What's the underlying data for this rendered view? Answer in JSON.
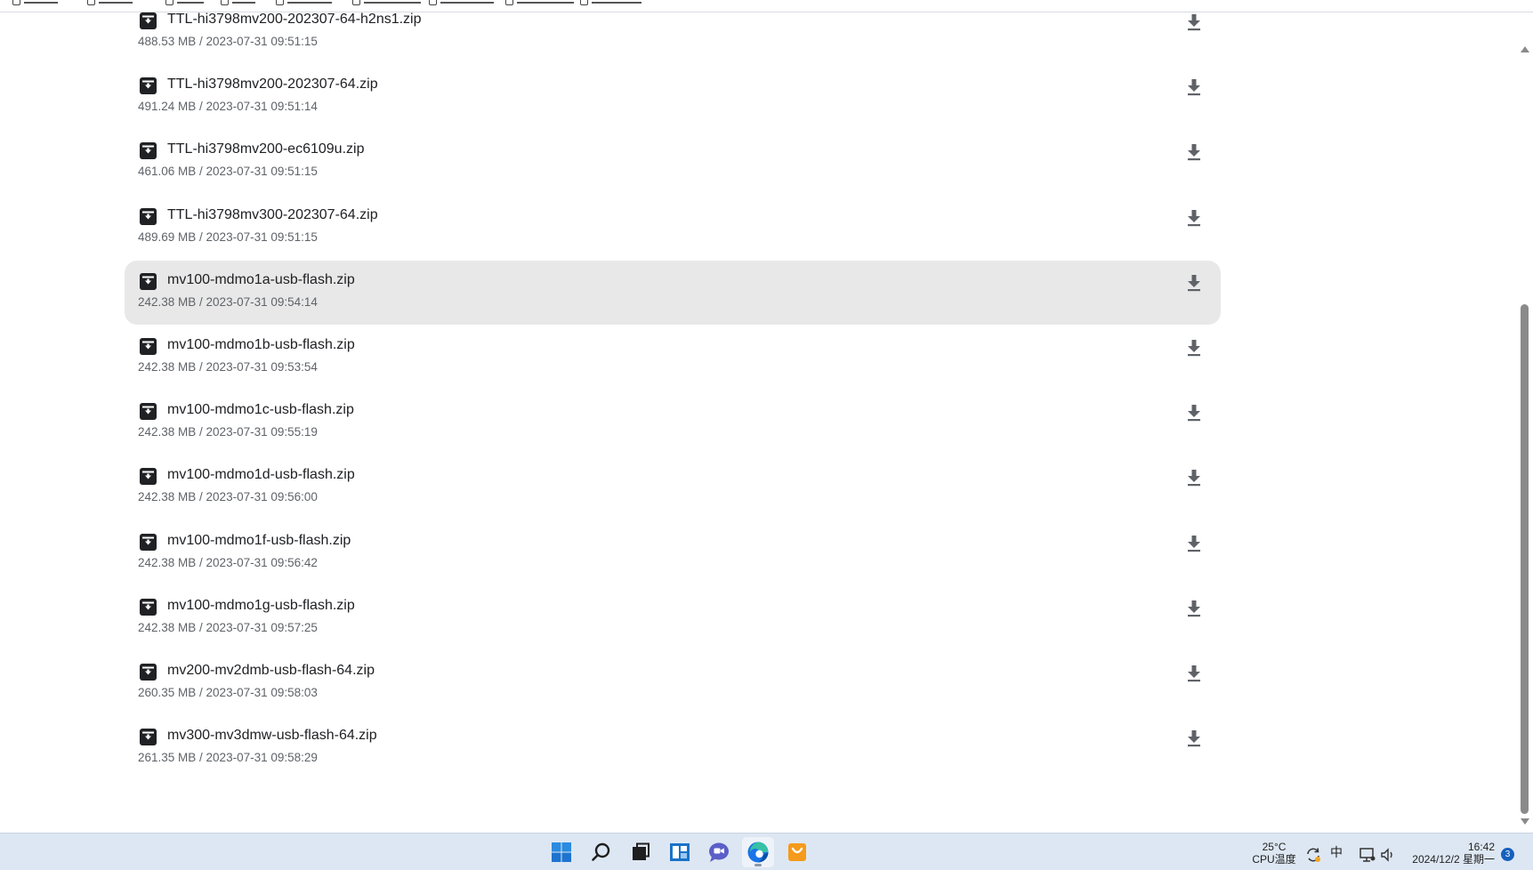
{
  "files": [
    {
      "name": "TTL-hi3798mv200-202307-64-h2ns1.zip",
      "meta": "488.53 MB / 2023-07-31 09:51:15"
    },
    {
      "name": "TTL-hi3798mv200-202307-64.zip",
      "meta": "491.24 MB / 2023-07-31 09:51:14"
    },
    {
      "name": "TTL-hi3798mv200-ec6109u.zip",
      "meta": "461.06 MB / 2023-07-31 09:51:15"
    },
    {
      "name": "TTL-hi3798mv300-202307-64.zip",
      "meta": "489.69 MB / 2023-07-31 09:51:15"
    },
    {
      "name": "mv100-mdmo1a-usb-flash.zip",
      "meta": "242.38 MB / 2023-07-31 09:54:14",
      "hovered": true
    },
    {
      "name": "mv100-mdmo1b-usb-flash.zip",
      "meta": "242.38 MB / 2023-07-31 09:53:54"
    },
    {
      "name": "mv100-mdmo1c-usb-flash.zip",
      "meta": "242.38 MB / 2023-07-31 09:55:19"
    },
    {
      "name": "mv100-mdmo1d-usb-flash.zip",
      "meta": "242.38 MB / 2023-07-31 09:56:00"
    },
    {
      "name": "mv100-mdmo1f-usb-flash.zip",
      "meta": "242.38 MB / 2023-07-31 09:56:42"
    },
    {
      "name": "mv100-mdmo1g-usb-flash.zip",
      "meta": "242.38 MB / 2023-07-31 09:57:25"
    },
    {
      "name": "mv200-mv2dmb-usb-flash-64.zip",
      "meta": "260.35 MB / 2023-07-31 09:58:03"
    },
    {
      "name": "mv300-mv3dmw-usb-flash-64.zip",
      "meta": "261.35 MB / 2023-07-31 09:58:29"
    }
  ],
  "taskbar": {
    "apps": [
      "windows-start-icon",
      "search-icon",
      "file-manager-icon",
      "widgets-icon",
      "chat-icon",
      "edge-browser-icon",
      "store-bag-icon"
    ],
    "active_app": "edge-browser-icon",
    "temperature": "25°C",
    "temperature_label": "CPU温度",
    "ime": "中",
    "time": "16:42",
    "date": "2024/12/2 星期一",
    "notifications": "3"
  },
  "colors": {
    "hover_row": "#e8e8e8",
    "taskbar": "#dde7f3",
    "meta_text": "#5f6368",
    "edge_blue": "#1a73e8",
    "store_orange": "#f59a1b"
  }
}
